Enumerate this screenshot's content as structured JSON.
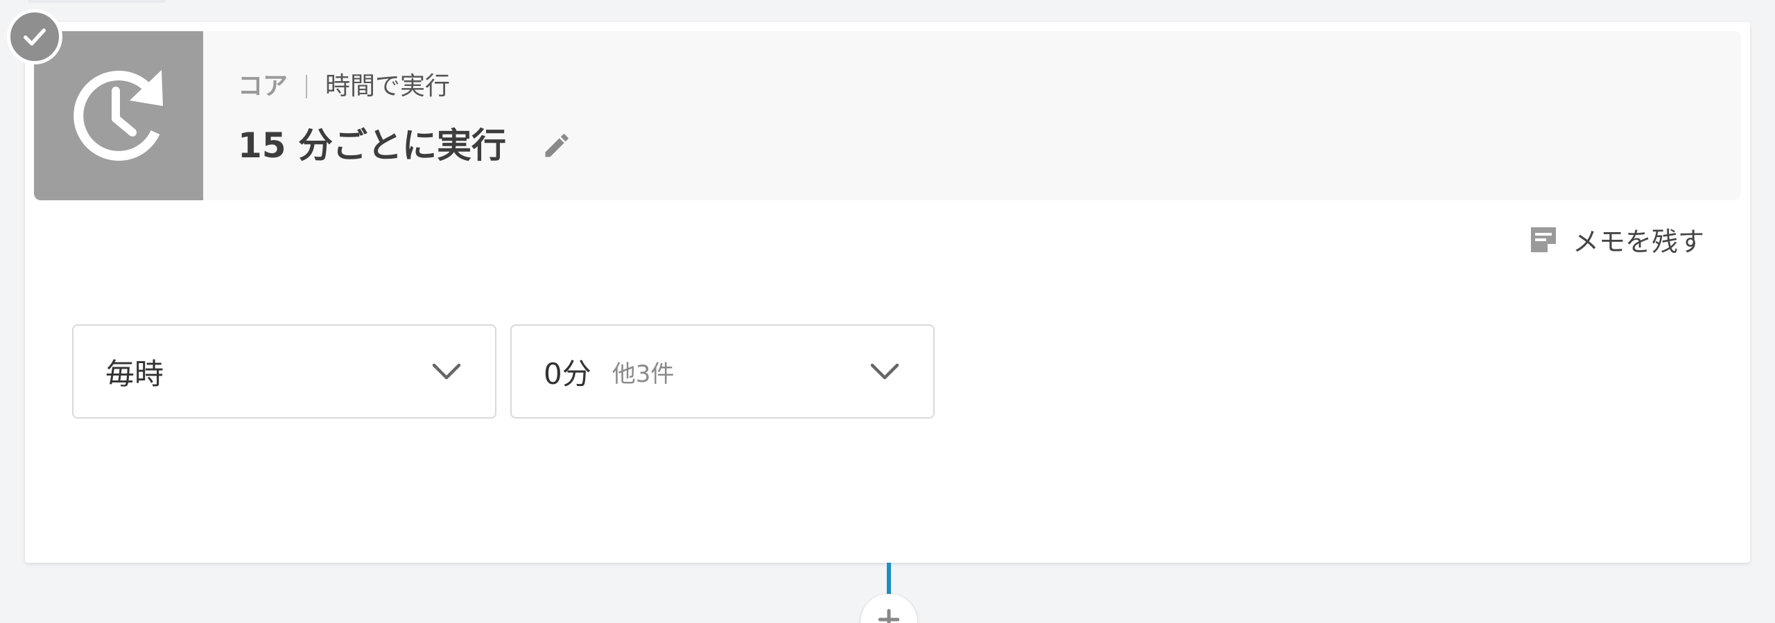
{
  "step": {
    "category": "コア",
    "action": "時間で実行",
    "title": "15 分ごとに実行",
    "status": "completed"
  },
  "memo": {
    "label": "メモを残す"
  },
  "trigger": {
    "frequency": {
      "value": "毎時"
    },
    "minute": {
      "value": "0分",
      "extra": "他3件"
    }
  },
  "icons": {
    "step_icon": "clock-refresh-icon",
    "status": "check-icon",
    "edit": "pencil-icon",
    "memo": "note-icon",
    "dropdown": "chevron-down-icon",
    "add": "plus-icon"
  },
  "colors": {
    "icon_tile": "#9e9e9e",
    "connector": "#1b8fc4",
    "status_badge": "#8f8f8f"
  }
}
